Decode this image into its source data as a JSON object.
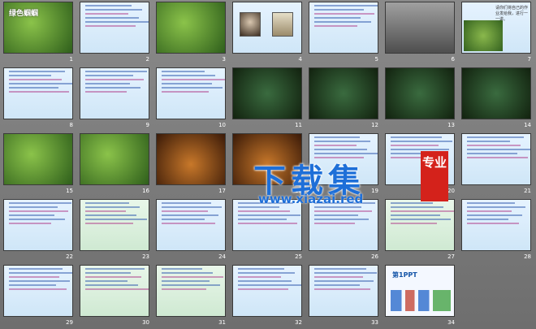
{
  "slides": [
    {
      "n": "1",
      "kind": "title",
      "title": "绿色蝈蝈"
    },
    {
      "n": "2",
      "kind": "pale"
    },
    {
      "n": "3",
      "kind": "green"
    },
    {
      "n": "4",
      "kind": "portrait"
    },
    {
      "n": "5",
      "kind": "pale"
    },
    {
      "n": "6",
      "kind": "photo"
    },
    {
      "n": "7",
      "kind": "mixed",
      "caption": "请你们将自己的作业发给我，进行一一讲。"
    },
    {
      "n": "8",
      "kind": "pale"
    },
    {
      "n": "9",
      "kind": "pale"
    },
    {
      "n": "10",
      "kind": "pale"
    },
    {
      "n": "11",
      "kind": "dark"
    },
    {
      "n": "12",
      "kind": "dark"
    },
    {
      "n": "13",
      "kind": "dark"
    },
    {
      "n": "14",
      "kind": "dark"
    },
    {
      "n": "15",
      "kind": "green"
    },
    {
      "n": "16",
      "kind": "green"
    },
    {
      "n": "17",
      "kind": "brown"
    },
    {
      "n": "18",
      "kind": "brown"
    },
    {
      "n": "19",
      "kind": "pale"
    },
    {
      "n": "20",
      "kind": "pale"
    },
    {
      "n": "21",
      "kind": "pale"
    },
    {
      "n": "22",
      "kind": "pale"
    },
    {
      "n": "23",
      "kind": "paleg"
    },
    {
      "n": "24",
      "kind": "pale"
    },
    {
      "n": "25",
      "kind": "pale"
    },
    {
      "n": "26",
      "kind": "pale"
    },
    {
      "n": "27",
      "kind": "paleg"
    },
    {
      "n": "28",
      "kind": "pale"
    },
    {
      "n": "29",
      "kind": "pale"
    },
    {
      "n": "30",
      "kind": "paleg"
    },
    {
      "n": "31",
      "kind": "paleg"
    },
    {
      "n": "32",
      "kind": "pale"
    },
    {
      "n": "33",
      "kind": "pale"
    },
    {
      "n": "34",
      "kind": "logo",
      "logo": "第1PPT"
    }
  ],
  "watermark": {
    "text": "下载集",
    "url": "www.xiazai.red",
    "badge": "专业"
  },
  "colors": {
    "background": "#7a7a7a",
    "watermark": "#1e6fd8",
    "badge": "#d4221b"
  }
}
